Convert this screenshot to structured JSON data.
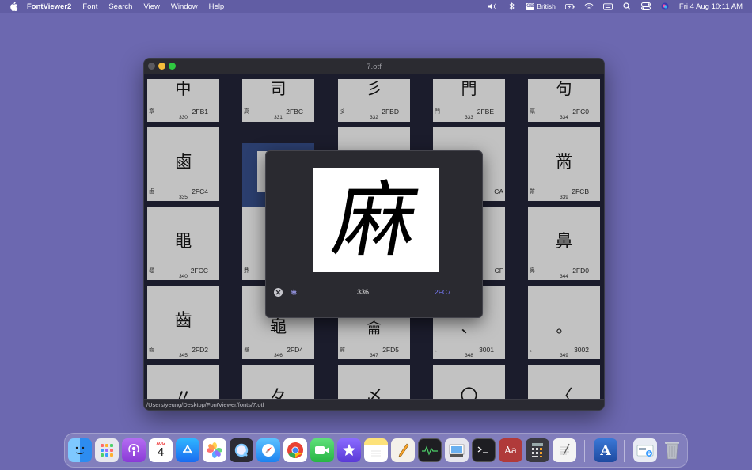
{
  "menubar": {
    "app_name": "FontViewer2",
    "items": [
      "Font",
      "Search",
      "View",
      "Window",
      "Help"
    ],
    "input_source": "British",
    "input_badge": "GB",
    "clock": "Fri 4 Aug  10:11 AM"
  },
  "window": {
    "title": "7.otf",
    "path": "/Users/yeung/Desktop/FontViewer/fonts/7.otf"
  },
  "rows": [
    {
      "cells": [
        {
          "glyph": "中",
          "label": "章",
          "code": "2FB1",
          "index": "330"
        },
        {
          "glyph": "司",
          "label": "高",
          "code": "2FBC",
          "index": "331"
        },
        {
          "glyph": "彡",
          "label": "彡",
          "code": "2FBD",
          "index": "332"
        },
        {
          "glyph": "門",
          "label": "門",
          "code": "2FBE",
          "index": "333"
        },
        {
          "glyph": "句",
          "label": "鬲",
          "code": "2FC0",
          "index": "334"
        }
      ]
    },
    {
      "cells": [
        {
          "glyph": "鹵",
          "label": "鹵",
          "code": "2FC4",
          "index": "335"
        },
        {
          "glyph": "",
          "label": "",
          "code": "",
          "index": ""
        },
        {
          "glyph": "",
          "label": "",
          "code": "",
          "index": ""
        },
        {
          "glyph": "",
          "label": "",
          "code": "CA",
          "index": ""
        },
        {
          "glyph": "黹",
          "label": "黹",
          "code": "2FCB",
          "index": "339"
        }
      ]
    },
    {
      "cells": [
        {
          "glyph": "黽",
          "label": "黽",
          "code": "2FCC",
          "index": "340"
        },
        {
          "glyph": "",
          "label": "鼎",
          "code": "",
          "index": ""
        },
        {
          "glyph": "",
          "label": "",
          "code": "",
          "index": ""
        },
        {
          "glyph": "",
          "label": "",
          "code": "CF",
          "index": ""
        },
        {
          "glyph": "鼻",
          "label": "鼻",
          "code": "2FD0",
          "index": "344"
        }
      ]
    },
    {
      "cells": [
        {
          "glyph": "齒",
          "label": "齒",
          "code": "2FD2",
          "index": "345"
        },
        {
          "glyph": "龜",
          "label": "龜",
          "code": "2FD4",
          "index": "346"
        },
        {
          "glyph": "龠",
          "label": "龠",
          "code": "2FD5",
          "index": "347"
        },
        {
          "glyph": "、",
          "label": "、",
          "code": "3001",
          "index": "348"
        },
        {
          "glyph": "。",
          "label": "。",
          "code": "3002",
          "index": "349"
        }
      ]
    },
    {
      "cells": [
        {
          "glyph": "〃",
          "label": "",
          "code": "",
          "index": ""
        },
        {
          "glyph": "々",
          "label": "",
          "code": "",
          "index": ""
        },
        {
          "glyph": "〆",
          "label": "",
          "code": "",
          "index": ""
        },
        {
          "glyph": "〇",
          "label": "",
          "code": "",
          "index": ""
        },
        {
          "glyph": "〈",
          "label": "",
          "code": "",
          "index": ""
        }
      ]
    }
  ],
  "popup": {
    "glyph": "麻",
    "small_char": "麻",
    "index": "336",
    "code": "2FC7"
  },
  "dock": {
    "calendar_month": "AUG",
    "calendar_day": "4",
    "apps": [
      {
        "name": "finder-icon",
        "color": "#2d8cf0"
      },
      {
        "name": "launchpad-icon",
        "color": "#e8e8ee"
      },
      {
        "name": "podcasts-icon",
        "color": "#9b4de0"
      },
      {
        "name": "calendar-icon",
        "color": "#ffffff"
      },
      {
        "name": "app-store-icon",
        "color": "#1f8cf5"
      },
      {
        "name": "photos-icon",
        "color": "#ffffff"
      },
      {
        "name": "quicktime-icon",
        "color": "#2b2b33"
      },
      {
        "name": "safari-icon",
        "color": "#1b82f0"
      },
      {
        "name": "chrome-icon",
        "color": "#ffffff"
      },
      {
        "name": "facetime-icon",
        "color": "#2fc84c"
      },
      {
        "name": "imovie-icon",
        "color": "#6b4de6"
      },
      {
        "name": "notes-icon",
        "color": "#fbd55a"
      },
      {
        "name": "pages-icon",
        "color": "#f4f1ea"
      },
      {
        "name": "activity-monitor-icon",
        "color": "#1e1e22"
      },
      {
        "name": "preview-icon",
        "color": "#e6e6ee"
      },
      {
        "name": "terminal-icon",
        "color": "#1e1e22"
      },
      {
        "name": "dictionary-icon",
        "color": "#b03a3a"
      },
      {
        "name": "calculator-icon",
        "color": "#3a3a40"
      },
      {
        "name": "textedit-icon",
        "color": "#f4f4f4"
      },
      {
        "name": "font-book-icon",
        "color": "#2a5cab"
      },
      {
        "name": "downloads-folder-icon",
        "color": "#e9ecf4"
      },
      {
        "name": "trash-icon",
        "color": "#b8bcc6"
      }
    ]
  }
}
